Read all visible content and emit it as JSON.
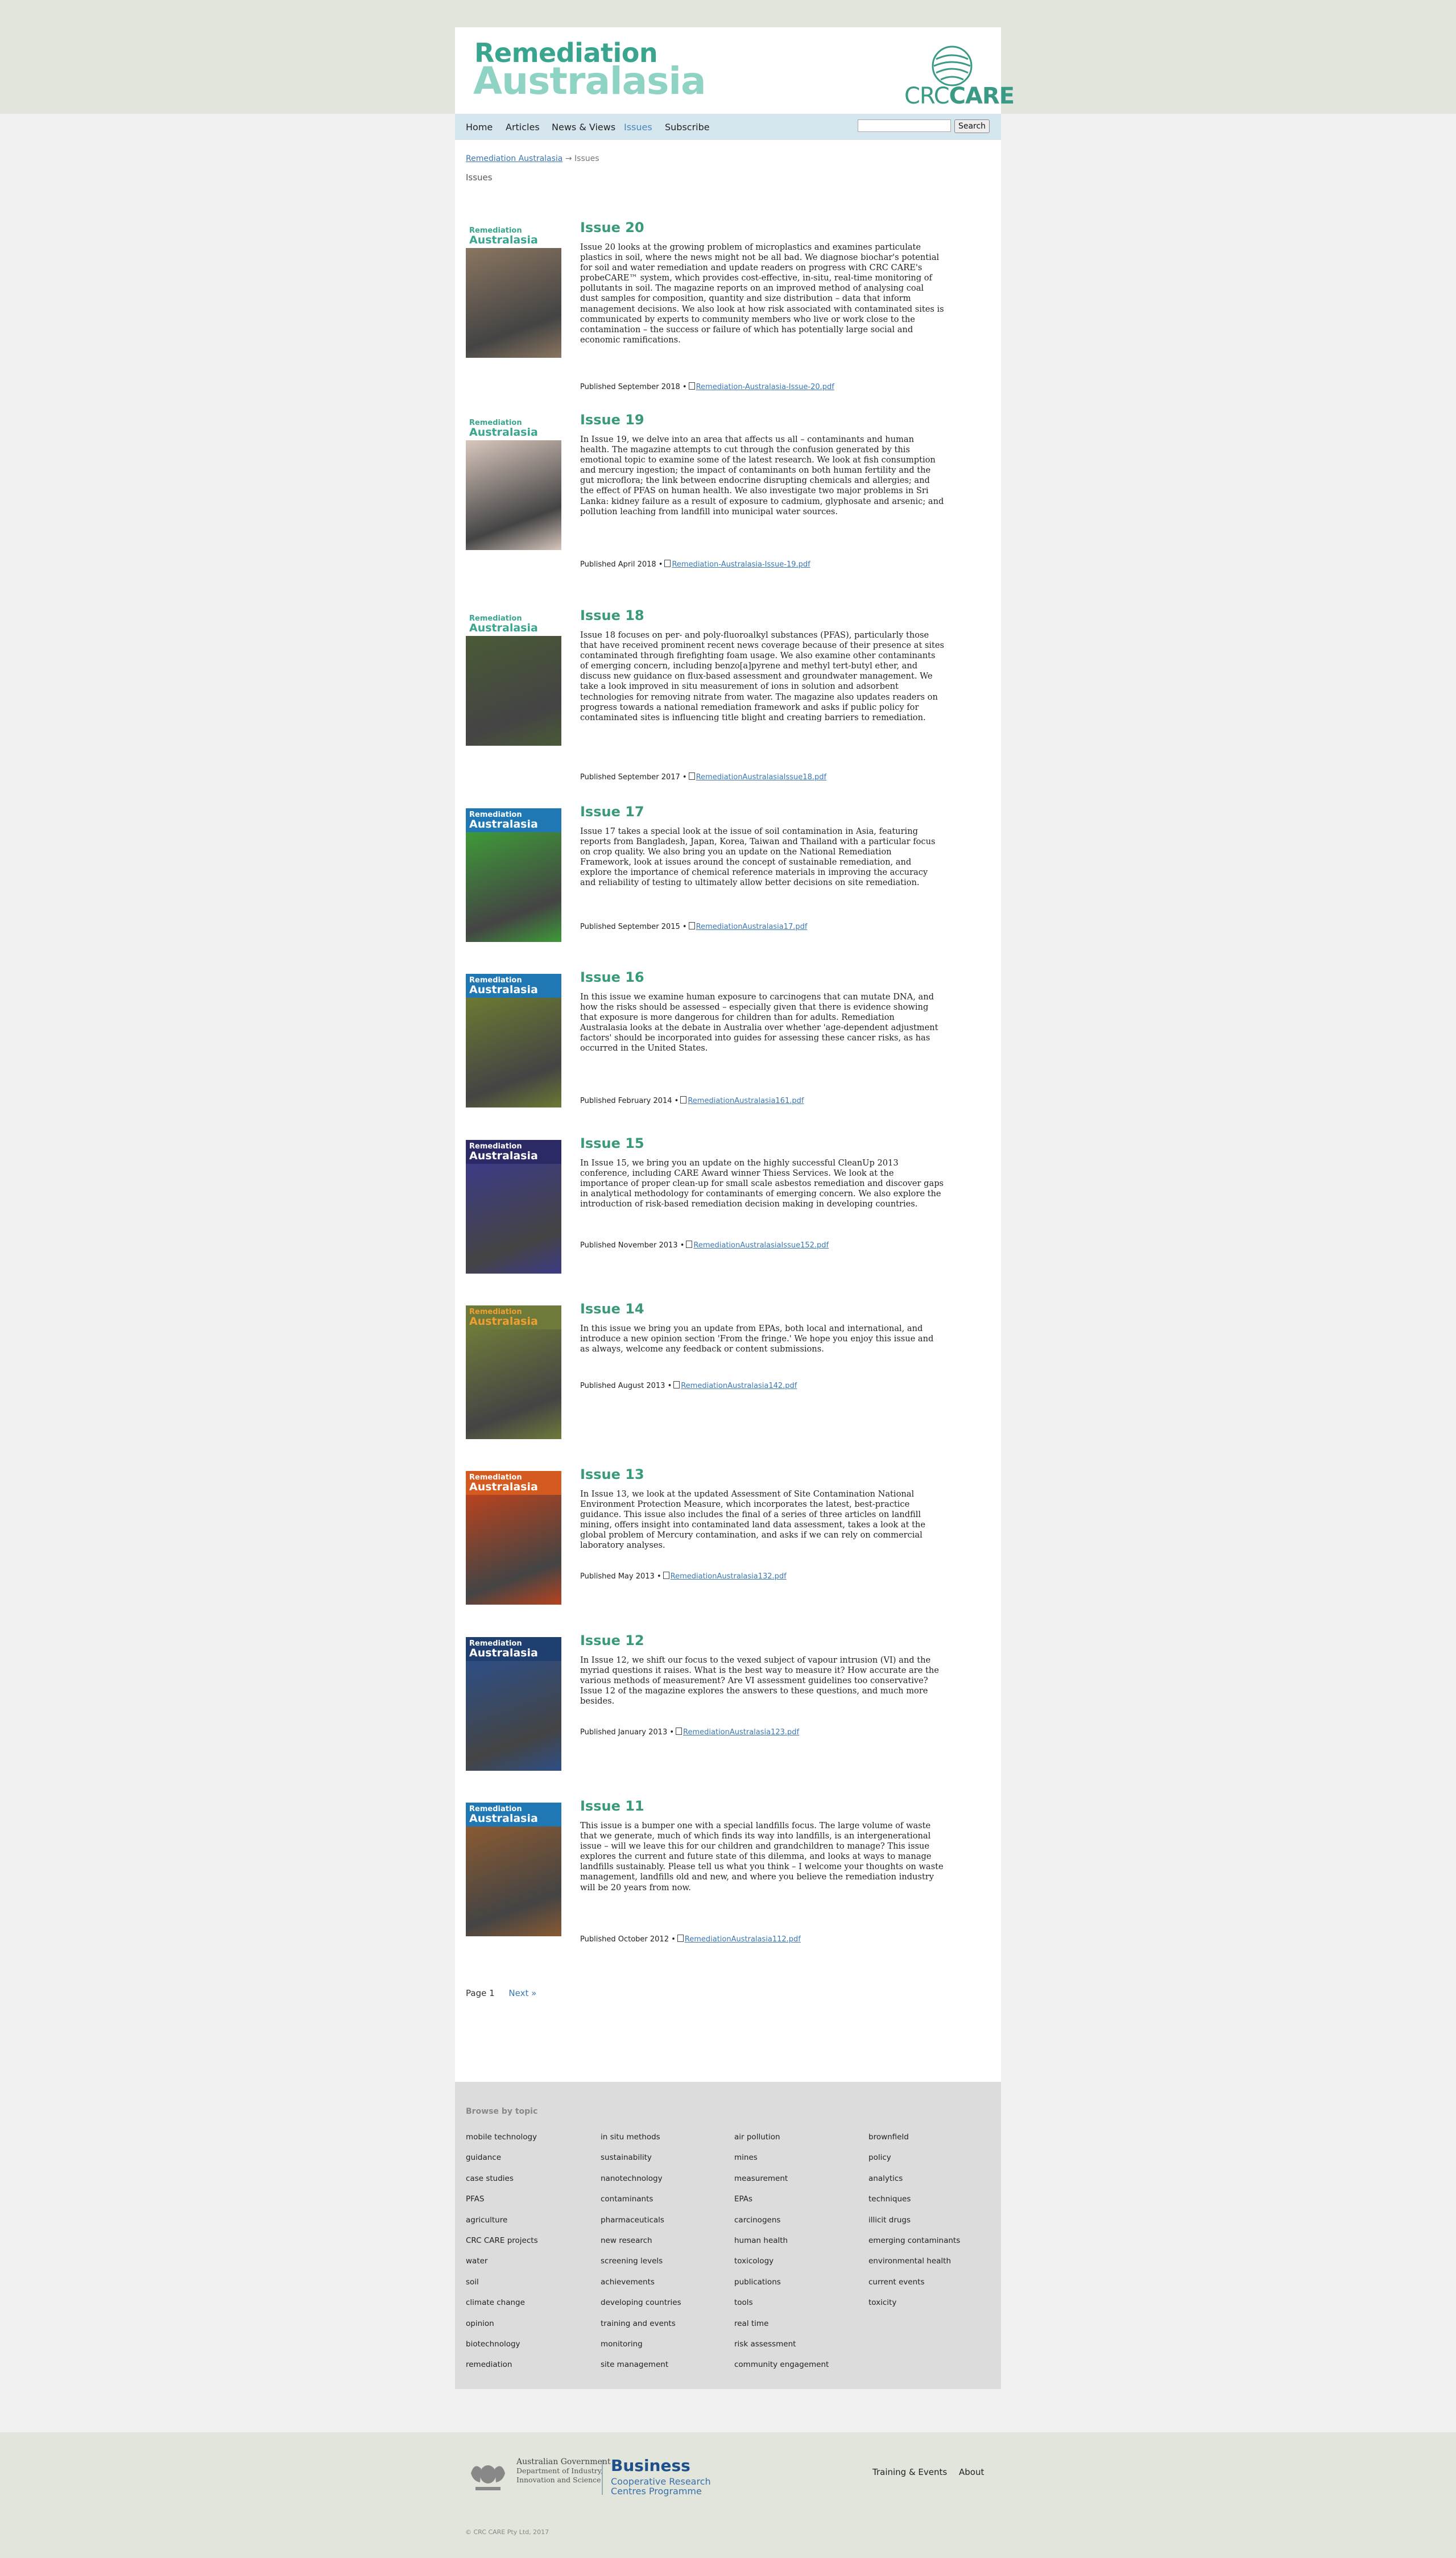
{
  "brand": {
    "title_line1": "Remediation",
    "title_line2": "Australasia",
    "partner_logo_light": "CRC",
    "partner_logo_bold": "CARE"
  },
  "nav": {
    "items": [
      "Home",
      "Articles",
      "News & Views",
      "Issues",
      "Subscribe"
    ],
    "active": "Issues",
    "search_value": "",
    "search_button": "Search"
  },
  "breadcrumb": {
    "root": "Remediation Australasia",
    "separator": "→",
    "current": "Issues",
    "page_title": "Issues"
  },
  "issues": [
    {
      "title": "Issue 20",
      "description": "Issue 20 looks at the growing problem of microplastics and examines particulate plastics in soil, where the news might not be all bad. We diagnose biochar's potential for soil and water remediation and update readers on progress with CRC CARE's probeCARE™ system, which provides cost-effective, in-situ, real-time monitoring of pollutants in soil. The magazine reports on an improved method of analysing coal dust samples for composition, quantity and size distribution – data that inform management decisions. We also look at how risk associated with contaminated sites is communicated by experts to community members who live or work close to the contamination – the success or failure of which has potentially large social and economic ramifications.",
      "published": "Published September 2018 •",
      "pdf": "Remediation-Australasia-Issue-20.pdf",
      "cover_bg": "#8a7560",
      "cover_band": "#ffffff",
      "cover_text": "#3aa58e"
    },
    {
      "title": "Issue 19",
      "description": "In Issue 19, we delve into an area that affects us all – contaminants and human health. The magazine attempts to cut through the confusion generated by this emotional topic to examine some of the latest research. We look at fish consumption and mercury ingestion; the impact of contaminants on both human fertility and the gut microflora; the link between endocrine disrupting chemicals and allergies; and the effect of PFAS on human health. We also investigate two major problems in Sri Lanka: kidney failure as a result of exposure to cadmium, glyphosate and arsenic; and pollution leaching from landfill into municipal water sources.",
      "published": "Published April 2018 •",
      "pdf": "Remediation-Australasia-Issue-19.pdf",
      "cover_bg": "#d9c7bd",
      "cover_band": "#ffffff",
      "cover_text": "#3aa58e"
    },
    {
      "title": "Issue 18",
      "description": "Issue 18 focuses on per- and poly-fluoroalkyl substances (PFAS), particularly those that have received prominent recent news coverage because of their presence at sites contaminated through firefighting foam usage. We also examine other contaminants of emerging concern, including benzo[a]pyrene and methyl tert-butyl ether, and discuss new guidance on flux-based assessment and groundwater management. We take a look improved in situ measurement of ions in solution and adsorbent technologies for removing nitrate from water. The magazine also updates readers on progress towards a national remediation framework and asks if public policy for contaminated sites is influencing title blight and creating barriers to remediation.",
      "published": "Published September 2017 •",
      "pdf": "RemediationAustralasiaIssue18.pdf",
      "cover_bg": "#4a5a36",
      "cover_band": "#ffffff",
      "cover_text": "#3aa58e"
    },
    {
      "title": "Issue 17",
      "description": "Issue 17 takes a special look at the issue of soil contamination in Asia, featuring reports from Bangladesh, Japan, Korea, Taiwan and Thailand with a particular focus on crop quality. We also bring you an update on the National Remediation Framework, look at issues around the concept of sustainable remediation, and explore the importance of chemical reference materials in improving the accuracy and reliability of testing to ultimately allow better decisions on site remediation.",
      "published": "Published September 2015 •",
      "pdf": "RemediationAustralasia17.pdf",
      "cover_bg": "#3e9a38",
      "cover_band": "#1f78b4",
      "cover_text": "#ffffff"
    },
    {
      "title": "Issue 16",
      "description": "In this issue we examine human exposure to carcinogens that can mutate DNA, and how the risks should be assessed – especially given that there is evidence showing that exposure is more dangerous for children than for adults. Remediation Australasia looks at the debate in Australia over whether 'age-dependent adjustment factors' should be incorporated into guides for assessing these cancer risks, as has occurred in the United States.",
      "published": "Published February 2014 •",
      "pdf": "RemediationAustralasia161.pdf",
      "cover_bg": "#6b7a32",
      "cover_band": "#1f78b4",
      "cover_text": "#ffffff"
    },
    {
      "title": "Issue 15",
      "description": "In Issue 15, we bring you an update on the highly successful CleanUp 2013 conference, including CARE Award winner Thiess Services. We look at the importance of proper clean-up for small scale asbestos remediation and discover gaps in analytical methodology for contaminants of emerging concern. We also explore the introduction of risk-based remediation decision making in developing countries.",
      "published": "Published November 2013 •",
      "pdf": "RemediationAustralasiaIssue152.pdf",
      "cover_bg": "#3d3b86",
      "cover_band": "#2b2a66",
      "cover_text": "#ffffff"
    },
    {
      "title": "Issue 14",
      "description": "In this issue we bring you an update from EPAs, both local and international, and introduce a new opinion section 'From the fringe.' We hope you enjoy this issue and as always, welcome any feedback or content submissions.",
      "published": "Published August 2013 •",
      "pdf": "RemediationAustralasia142.pdf",
      "cover_bg": "#6e7a3a",
      "cover_band": "#6e7a3a",
      "cover_text": "#f0a030"
    },
    {
      "title": "Issue 13",
      "description": "In Issue 13, we look at the updated Assessment of Site Contamination National Environment Protection Measure, which incorporates the latest, best-practice guidance. This issue also includes the final of a series of three articles on landfill mining, offers insight into contaminated land data assessment, takes a look at the global problem of Mercury contamination, and asks if we can rely on commercial laboratory analyses.",
      "published": "Published May 2013 •",
      "pdf": "RemediationAustralasia132.pdf",
      "cover_bg": "#b8431e",
      "cover_band": "#d45a20",
      "cover_text": "#ffffff"
    },
    {
      "title": "Issue 12",
      "description": "In Issue 12, we shift our focus to the vexed subject of vapour intrusion (VI) and the myriad questions it raises. What is the best way to measure it? How accurate are the various methods of measurement? Are VI assessment guidelines too conservative? Issue 12 of the magazine explores the answers to these questions, and much more besides.",
      "published": "Published January 2013 •",
      "pdf": "RemediationAustralasia123.pdf",
      "cover_bg": "#2e4f86",
      "cover_band": "#1f3f70",
      "cover_text": "#ffffff"
    },
    {
      "title": "Issue 11",
      "description": "This issue is a bumper one with a special landfills focus. The large volume of waste that we generate, much of which finds its way into landfills, is an intergenerational issue – will we leave this for our children and grandchildren to manage? This issue explores the current and future state of this dilemma, and looks at ways to manage landfills sustainably. Please tell us what you think – I welcome your thoughts on waste management, landfills old and new, and where you believe the remediation industry will be 20 years from now.",
      "published": "Published October 2012 •",
      "pdf": "RemediationAustralasia112.pdf",
      "cover_bg": "#8a5a32",
      "cover_band": "#1f78b4",
      "cover_text": "#ffffff"
    }
  ],
  "pager": {
    "current": "Page 1",
    "next": "Next »"
  },
  "browse": {
    "title": "Browse by topic",
    "columns": [
      [
        "mobile technology",
        "guidance",
        "case studies",
        "PFAS",
        "agriculture",
        "CRC CARE projects",
        "water",
        "soil",
        "climate change",
        "opinion",
        "biotechnology",
        "remediation"
      ],
      [
        "in situ methods",
        "sustainability",
        "nanotechnology",
        "contaminants",
        "pharmaceuticals",
        "new research",
        "screening levels",
        "achievements",
        "developing countries",
        "training and events",
        "monitoring",
        "site management"
      ],
      [
        "air pollution",
        "mines",
        "measurement",
        "EPAs",
        "carcinogens",
        "human health",
        "toxicology",
        "publications",
        "tools",
        "real time",
        "risk assessment",
        "community engagement"
      ],
      [
        "brownfield",
        "policy",
        "analytics",
        "techniques",
        "illicit drugs",
        "emerging contaminants",
        "environmental health",
        "current events",
        "toxicity"
      ]
    ]
  },
  "footer": {
    "gov_line1": "Australian Government",
    "gov_line2": "Department of Industry,",
    "gov_line3": "Innovation and Science",
    "biz_title": "Business",
    "biz_sub1": "Cooperative Research",
    "biz_sub2": "Centres Programme",
    "links": [
      "Training & Events",
      "About"
    ],
    "copyright": "© CRC CARE Pty Ltd, 2017"
  }
}
